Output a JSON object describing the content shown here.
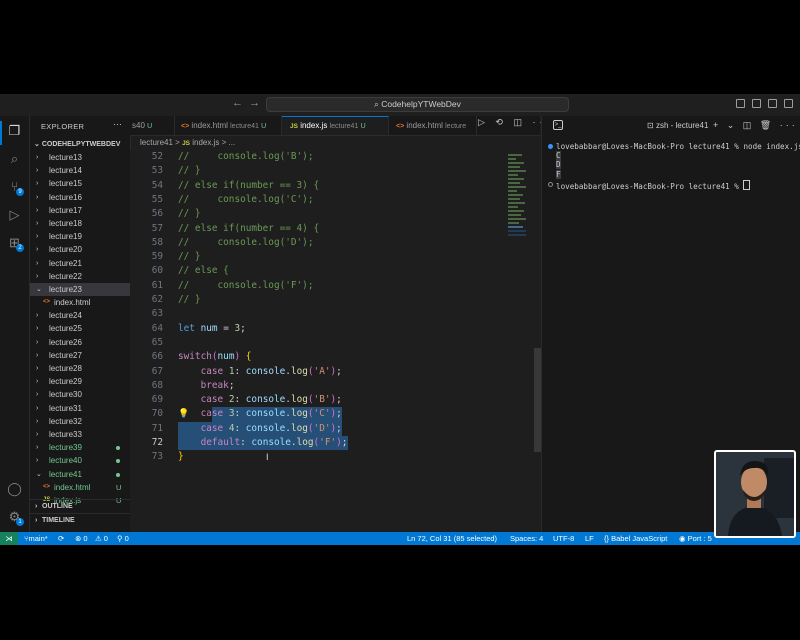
{
  "titlebar": {
    "search_text": "CodehelpYTWebDev"
  },
  "activity_bar": {
    "items": [
      {
        "icon": "files-icon"
      },
      {
        "icon": "search-icon"
      },
      {
        "icon": "source-control-icon",
        "badge": "9"
      },
      {
        "icon": "run-debug-icon"
      },
      {
        "icon": "extensions-icon",
        "badge": "2"
      }
    ],
    "bottom": [
      {
        "icon": "account-icon"
      },
      {
        "icon": "settings-gear-icon",
        "badge": "1"
      }
    ]
  },
  "sidebar": {
    "title": "EXPLORER",
    "more": "···",
    "root": "CODEHELPYTWEBDEV",
    "tree": [
      {
        "label": "lecture13",
        "type": "folder"
      },
      {
        "label": "lecture14",
        "type": "folder"
      },
      {
        "label": "lecture15",
        "type": "folder"
      },
      {
        "label": "lecture16",
        "type": "folder"
      },
      {
        "label": "lecture17",
        "type": "folder"
      },
      {
        "label": "lecture18",
        "type": "folder"
      },
      {
        "label": "lecture19",
        "type": "folder"
      },
      {
        "label": "lecture20",
        "type": "folder"
      },
      {
        "label": "lecture21",
        "type": "folder"
      },
      {
        "label": "lecture22",
        "type": "folder"
      },
      {
        "label": "lecture23",
        "type": "folder-open",
        "selected": true
      },
      {
        "label": "index.html",
        "type": "file-html"
      },
      {
        "label": "lecture24",
        "type": "folder"
      },
      {
        "label": "lecture25",
        "type": "folder"
      },
      {
        "label": "lecture26",
        "type": "folder"
      },
      {
        "label": "lecture27",
        "type": "folder"
      },
      {
        "label": "lecture28",
        "type": "folder"
      },
      {
        "label": "lecture29",
        "type": "folder"
      },
      {
        "label": "lecture30",
        "type": "folder"
      },
      {
        "label": "lecture31",
        "type": "folder"
      },
      {
        "label": "lecture32",
        "type": "folder"
      },
      {
        "label": "lecture33",
        "type": "folder"
      },
      {
        "label": "lecture39",
        "type": "folder",
        "git": "dot"
      },
      {
        "label": "lecture40",
        "type": "folder",
        "git": "dot"
      },
      {
        "label": "lecture41",
        "type": "folder-open",
        "git": "dot"
      },
      {
        "label": "index.html",
        "type": "file-html",
        "git": "U"
      },
      {
        "label": "index.js",
        "type": "file-js",
        "git": "U"
      }
    ],
    "sections": [
      "OUTLINE",
      "TIMELINE"
    ]
  },
  "tabs": [
    {
      "name": "s40",
      "dir": "",
      "status": "U"
    },
    {
      "name": "index.html",
      "dir": "lecture41",
      "status": "U",
      "ext": "html"
    },
    {
      "name": "index.js",
      "dir": "lecture41",
      "status": "U",
      "ext": "js",
      "active": true
    },
    {
      "name": "index.html",
      "dir": "lecture",
      "status": "",
      "ext": "html"
    }
  ],
  "editor_actions": "▷ ⟲ ◫ ···",
  "breadcrumb": {
    "folder": "lecture41",
    "sep": ">",
    "js_badge": "JS",
    "file": "index.js",
    "tail": "> ..."
  },
  "code": [
    {
      "n": "52",
      "t": "//     console.log('B');"
    },
    {
      "n": "53",
      "t": "// }"
    },
    {
      "n": "54",
      "t": "// else if(number == 3) {"
    },
    {
      "n": "55",
      "t": "//     console.log('C');"
    },
    {
      "n": "56",
      "t": "// }"
    },
    {
      "n": "57",
      "t": "// else if(number == 4) {"
    },
    {
      "n": "58",
      "t": "//     console.log('D');"
    },
    {
      "n": "59",
      "t": "// }"
    },
    {
      "n": "60",
      "t": "// else {"
    },
    {
      "n": "61",
      "t": "//     console.log('F');"
    },
    {
      "n": "62",
      "t": "// }"
    },
    {
      "n": "63",
      "t": ""
    },
    {
      "n": "64",
      "t": "let num = 3;"
    },
    {
      "n": "65",
      "t": ""
    },
    {
      "n": "66",
      "t": "switch(num) {"
    },
    {
      "n": "67",
      "t": "    case 1: console.log('A');"
    },
    {
      "n": "68",
      "t": "    break;"
    },
    {
      "n": "69",
      "t": "    case 2: console.log('B');"
    },
    {
      "n": "70",
      "t": "    case 3: console.log('C');"
    },
    {
      "n": "71",
      "t": "    case 4: console.log('D');"
    },
    {
      "n": "72",
      "t": "    default: console.log('F');"
    },
    {
      "n": "73",
      "t": "}"
    }
  ],
  "terminal": {
    "shell_tab": "zsh - lecture41",
    "actions": "+ ⌄ ◫ 🗑 ··· ∧ ✕",
    "lines": [
      {
        "text": "lovebabbar@Loves-MacBook-Pro lecture41 % node index.js",
        "bullet": "blue"
      },
      {
        "text": "C",
        "bullet": "",
        "hl": true
      },
      {
        "text": "D",
        "bullet": "",
        "hl": true
      },
      {
        "text": "F",
        "bullet": "",
        "hl": true
      },
      {
        "text": "lovebabbar@Loves-MacBook-Pro lecture41 % ",
        "bullet": "hollow",
        "cursor": true
      }
    ]
  },
  "statusbar": {
    "remote": "⋊",
    "branch": "main*",
    "sync": "⟳",
    "errors": "⊗ 0",
    "warnings": "⚠ 0",
    "ports_count": "⚲ 0",
    "position": "Ln 72, Col 31 (85 selected)",
    "spaces": "Spaces: 4",
    "encoding": "UTF-8",
    "eol": "LF",
    "language": "Babel JavaScript",
    "port": "Port : 5"
  },
  "colors": {
    "accent": "#0078d4",
    "git_untracked": "#73c991",
    "selection": "#264f78"
  }
}
